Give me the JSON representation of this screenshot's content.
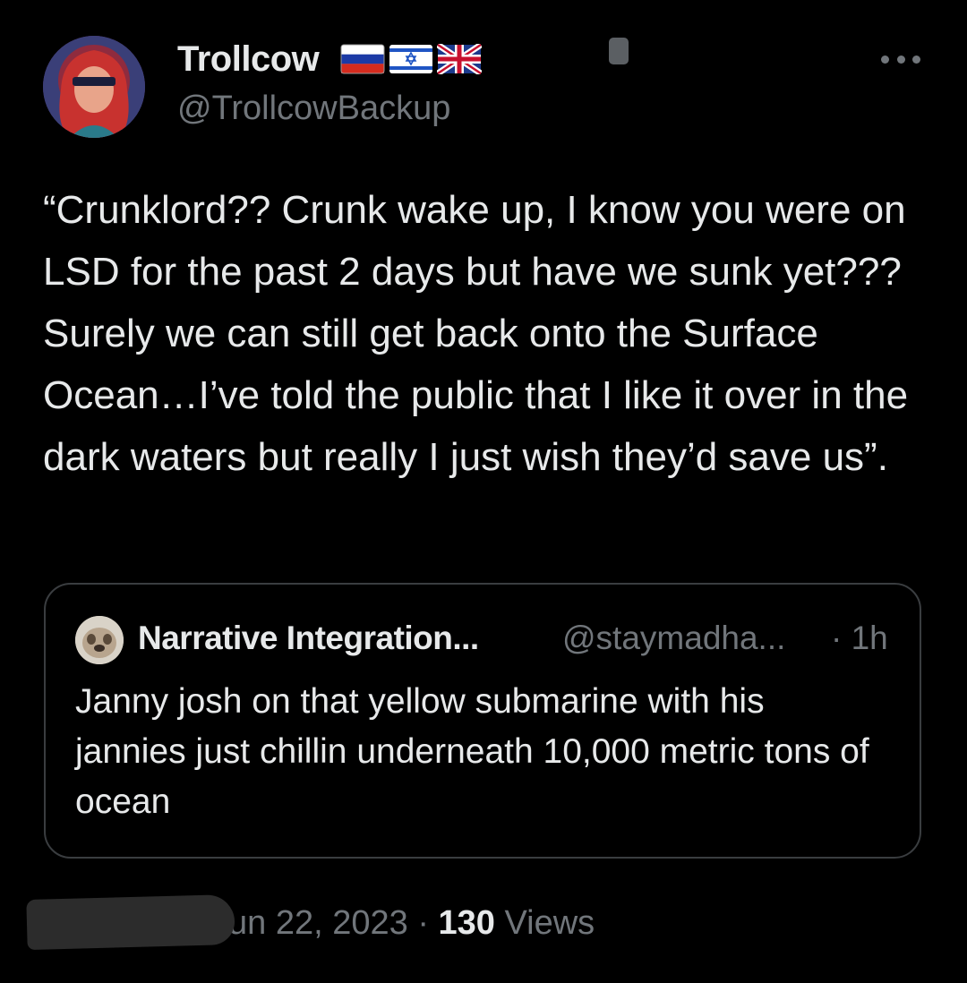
{
  "tweet": {
    "author": {
      "display_name": "Trollcow",
      "handle": "@TrollcowBackup",
      "flags": [
        "russia-flag",
        "israel-flag",
        "uk-flag"
      ]
    },
    "text": "“Crunklord?? Crunk wake up, I know you were on LSD for the past 2 days but have we sunk yet??? Surely we can still get back onto the Surface Ocean…I’ve told the public that I like it over in the dark waters but really I just wish they’d save us”.",
    "date": "Jun 22, 2023",
    "separator": "·",
    "views_count": "130",
    "views_label": "Views"
  },
  "quote": {
    "author_name": "Narrative Integration...",
    "author_handle": "@staymadha...",
    "time": "· 1h",
    "text": "Janny josh on that yellow submarine with his jannies just chillin underneath 10,000 metric tons of ocean"
  },
  "icons": {
    "more": "more-options-icon"
  },
  "colors": {
    "background": "#000000",
    "primary_text": "#e7e9ea",
    "secondary_text": "#71767b",
    "card_border": "#3a3d40"
  }
}
